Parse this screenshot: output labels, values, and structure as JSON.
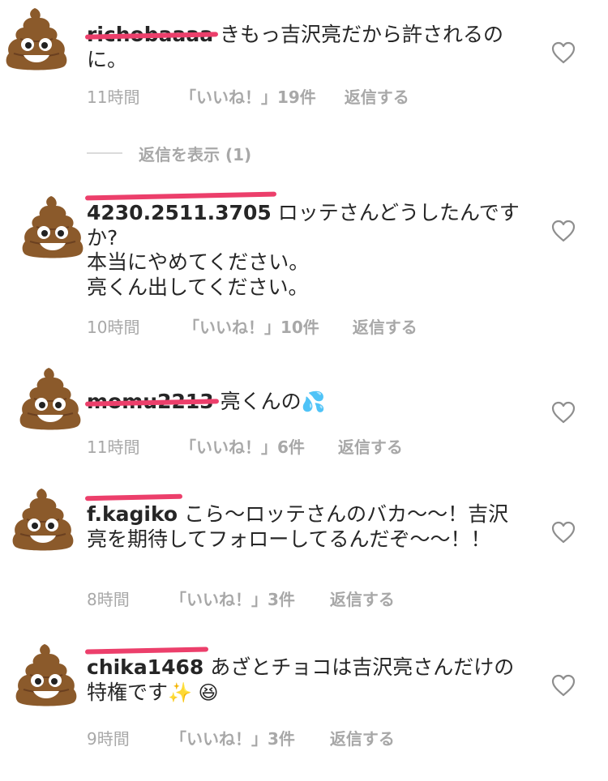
{
  "comments": [
    {
      "username": "richobaaaa",
      "text": "きもっ吉沢亮だから許されるのに。",
      "time": "11時間",
      "likes": "「いいね！」19件",
      "reply": "返信する"
    },
    {
      "username": "4230.2511.3705",
      "text": "ロッテさんどうしたんですか?\n本当にやめてください。\n亮くん出してください。",
      "time": "10時間",
      "likes": "「いいね！」10件",
      "reply": "返信する"
    },
    {
      "username": "momu2213",
      "text": "亮くんの",
      "emoji": "💦",
      "time": "11時間",
      "likes": "「いいね！」6件",
      "reply": "返信する"
    },
    {
      "username": "f.kagiko",
      "text": "こら〜ロッテさんのバカ〜〜！吉沢亮を期待してフォローしてるんだぞ〜〜！！",
      "time": "8時間",
      "likes": "「いいね！」3件",
      "reply": "返信する"
    },
    {
      "username": "chika1468",
      "text": "あざとチョコは吉沢亮さんだけの特権です",
      "emoji": "✨ 😆",
      "time": "9時間",
      "likes": "「いいね！」3件",
      "reply": "返信する"
    }
  ],
  "view_replies": "返信を表示 (1)",
  "icons": {
    "avatar": "poop-emoji-avatar",
    "like": "heart-outline-icon"
  },
  "colors": {
    "redaction": "#ec3f6b",
    "meta": "#a8a8a8",
    "text": "#262626"
  }
}
